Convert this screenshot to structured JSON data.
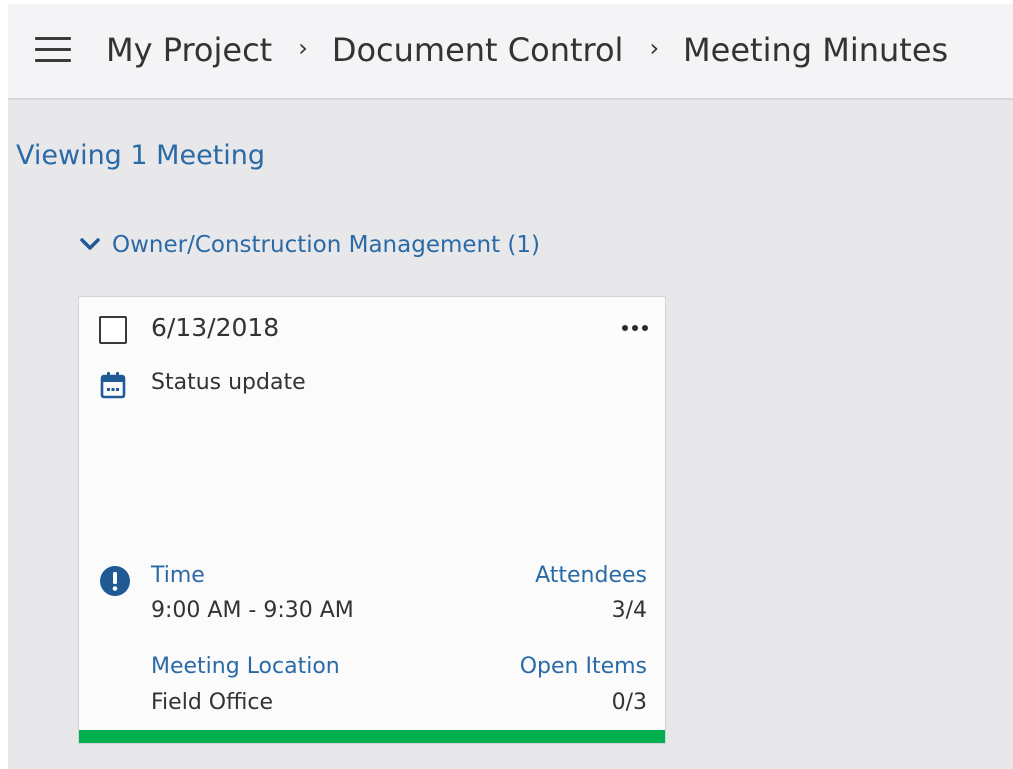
{
  "header": {
    "breadcrumbs": [
      "My Project",
      "Document Control",
      "Meeting Minutes"
    ],
    "separator": "›"
  },
  "summary": {
    "viewing_text": "Viewing 1 Meeting"
  },
  "group": {
    "label": "Owner/Construction Management (1)",
    "expanded": true
  },
  "meeting": {
    "date": "6/13/2018",
    "subject": "Status update",
    "time_label": "Time",
    "time_value": "9:00 AM - 9:30 AM",
    "attendees_label": "Attendees",
    "attendees_value": "3/4",
    "location_label": "Meeting Location",
    "location_value": "Field Office",
    "open_items_label": "Open Items",
    "open_items_value": "0/3",
    "status_color": "#00b050"
  },
  "colors": {
    "accent": "#2a6aa6",
    "icon_blue": "#1f5a94"
  },
  "icons": [
    "menu-icon",
    "chevron-down-icon",
    "checkbox-icon",
    "more-horizontal-icon",
    "calendar-icon",
    "alert-circle-icon"
  ]
}
